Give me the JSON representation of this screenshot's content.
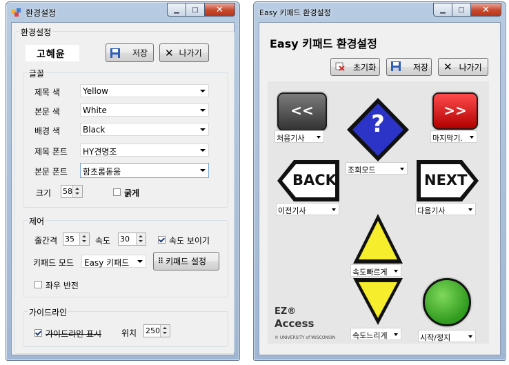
{
  "left_window": {
    "title": "환경설정",
    "main_group": "환경설정",
    "user_name": "고혜윤",
    "save_label": "저장",
    "exit_label": "나가기",
    "font_group": {
      "label": "글꼴",
      "title_color_label": "제목 색",
      "title_color_value": "Yellow",
      "body_color_label": "본문 색",
      "body_color_value": "White",
      "bg_color_label": "배경 색",
      "bg_color_value": "Black",
      "title_font_label": "제목 폰트",
      "title_font_value": "HY견명조",
      "body_font_label": "본문 폰트",
      "body_font_value": "함초롬돋움",
      "size_label": "크기",
      "size_value": "58",
      "bold_label": "굵게",
      "bold_checked": false
    },
    "control_group": {
      "label": "제어",
      "line_spacing_label": "줄간격",
      "line_spacing_value": "35",
      "speed_label": "속도",
      "speed_value": "30",
      "show_speed_label": "속도 보이기",
      "show_speed_checked": true,
      "keypad_mode_label": "키패드 모드",
      "keypad_mode_value": "Easy 키패드",
      "keypad_settings_label": "키패드 설정",
      "mirror_label": "좌우 반전",
      "mirror_checked": false
    },
    "guide_group": {
      "label": "가이드라인",
      "show_guide_label": "가이드라인 표시",
      "show_guide_checked": true,
      "position_label": "위치",
      "position_value": "250"
    }
  },
  "right_window": {
    "title": "Easy 키패드 환경설정",
    "heading": "Easy 키패드 환경설정",
    "reset_label": "초기화",
    "save_label": "저장",
    "exit_label": "나가기",
    "keypad": {
      "key_prev_label": "<<",
      "key_next_label": ">>",
      "key_help_label": "?",
      "key_back_label": "BACK",
      "key_forward_label": "NEXT",
      "combo_first": "처음기사",
      "combo_last": "마지막기.",
      "combo_help": "조회모드",
      "combo_back": "이전기사",
      "combo_forward": "다음기사",
      "combo_up": "속도빠르게",
      "combo_down": "속도느리게",
      "combo_go": "시작/정지",
      "brand_line1": "EZ®",
      "brand_line2": "Access",
      "brand_small": "© UNIVERSITY of WISCONSIN"
    }
  }
}
